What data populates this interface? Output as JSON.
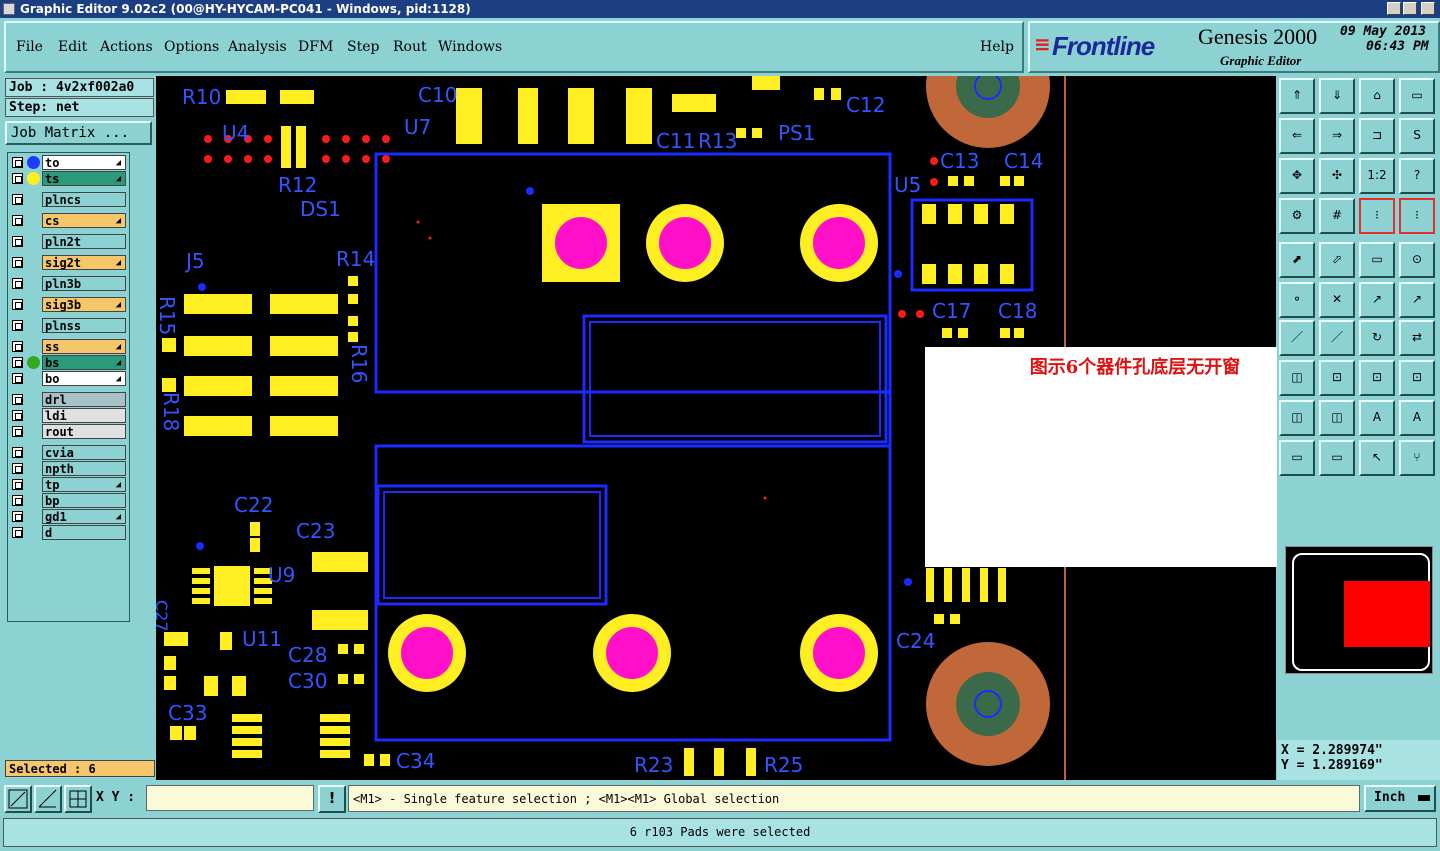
{
  "window": {
    "title": "Graphic Editor 9.02c2 (00@HY-HYCAM-PC041 - Windows, pid:1128)"
  },
  "menu": {
    "items": [
      "File",
      "Edit",
      "Actions",
      "Options",
      "Analysis",
      "DFM",
      "Step",
      "Rout",
      "Windows"
    ],
    "help": "Help"
  },
  "brand": {
    "logo": "Frontline",
    "product": "Genesis 2000",
    "subtitle": "Graphic Editor",
    "date": "09 May 2013",
    "time": "06:43 PM"
  },
  "job": {
    "job": "Job : 4v2xf002a0",
    "step": "Step: net",
    "matrix": "Job Matrix ..."
  },
  "layers": [
    {
      "name": "to",
      "color": "#ffffff",
      "dot": "#1a3cff",
      "marked": true
    },
    {
      "name": "ts",
      "color": "#2a9a7a",
      "dot": "#ffee22",
      "marked": true
    },
    {
      "name": "plncs",
      "color": "#8cd2d2",
      "dot": "",
      "marked": false
    },
    {
      "name": "cs",
      "color": "#f5c66a",
      "dot": "",
      "marked": true
    },
    {
      "name": "pln2t",
      "color": "#8cd2d2",
      "dot": "",
      "marked": false
    },
    {
      "name": "sig2t",
      "color": "#f5c66a",
      "dot": "",
      "marked": true
    },
    {
      "name": "pln3b",
      "color": "#8cd2d2",
      "dot": "",
      "marked": false
    },
    {
      "name": "sig3b",
      "color": "#f5c66a",
      "dot": "",
      "marked": true
    },
    {
      "name": "plnss",
      "color": "#8cd2d2",
      "dot": "",
      "marked": false
    },
    {
      "name": "ss",
      "color": "#f5c66a",
      "dot": "",
      "marked": true
    },
    {
      "name": "bs",
      "color": "#2a9a7a",
      "dot": "#33aa22",
      "marked": true
    },
    {
      "name": "bo",
      "color": "#ffffff",
      "dot": "",
      "marked": true
    },
    {
      "name": "drl",
      "color": "#a8c0c8",
      "dot": "",
      "marked": false
    },
    {
      "name": "ldi",
      "color": "#e0e0e0",
      "dot": "",
      "marked": false
    },
    {
      "name": "rout",
      "color": "#e0e0e0",
      "dot": "",
      "marked": false
    },
    {
      "name": "cvia",
      "color": "#8cd2d2",
      "dot": "",
      "marked": false
    },
    {
      "name": "npth",
      "color": "#8cd2d2",
      "dot": "",
      "marked": false
    },
    {
      "name": "tp",
      "color": "#8cd2d2",
      "dot": "",
      "marked": true
    },
    {
      "name": "bp",
      "color": "#8cd2d2",
      "dot": "",
      "marked": false
    },
    {
      "name": "gd1",
      "color": "#8cd2d2",
      "dot": "",
      "marked": true
    },
    {
      "name": "d",
      "color": "#8cd2d2",
      "dot": "",
      "marked": false
    }
  ],
  "selected": "Selected : 6",
  "canvas_labels": [
    "R10",
    "C10",
    "C12",
    "U4",
    "U7",
    "C11",
    "R13",
    "PS1",
    "R12",
    "C13",
    "C14",
    "U5",
    "DS1",
    "J5",
    "R14",
    "R15",
    "R16",
    "C17",
    "C18",
    "R18",
    "C22",
    "C23",
    "U9",
    "C27",
    "U11",
    "C28",
    "C30",
    "C33",
    "C34",
    "R23",
    "R25",
    "C24"
  ],
  "note": "图示6个器件孔底层无开窗",
  "coords": {
    "x": "X = 2.289974\"",
    "y": "Y = 1.289169\""
  },
  "input": {
    "xy_label": "X Y :",
    "xy_value": ""
  },
  "hint": "<M1> - Single feature selection ; <M1><M1> Global selection",
  "unit": "Inch",
  "status": "6 r103 Pads were selected",
  "toolbar_icons": [
    "home-up-icon",
    "home-down-icon",
    "home-icon",
    "window-icon",
    "move-left-icon",
    "move-right-icon",
    "zoom-out-icon",
    "zoom-s-icon",
    "fit-icon",
    "center-icon",
    "ratio-icon",
    "help-icon",
    "settings-icon",
    "grid-icon",
    "snap-a-icon",
    "snap-b-icon",
    "select-icon",
    "polygon-icon",
    "measure-icon",
    "record-icon",
    "net-icon",
    "cross-icon",
    "probe-a-icon",
    "probe-b-icon",
    "line-icon",
    "line-b-icon",
    "rotate-icon",
    "flip-icon",
    "icon-row9-a",
    "icon-row9-b",
    "icon-row9-c",
    "icon-row9-d",
    "icon-row10-a",
    "icon-row10-b",
    "arc-a-icon",
    "arc-b-icon",
    "icon-row11-a",
    "icon-row11-b",
    "pointer-icon",
    "route-icon"
  ]
}
